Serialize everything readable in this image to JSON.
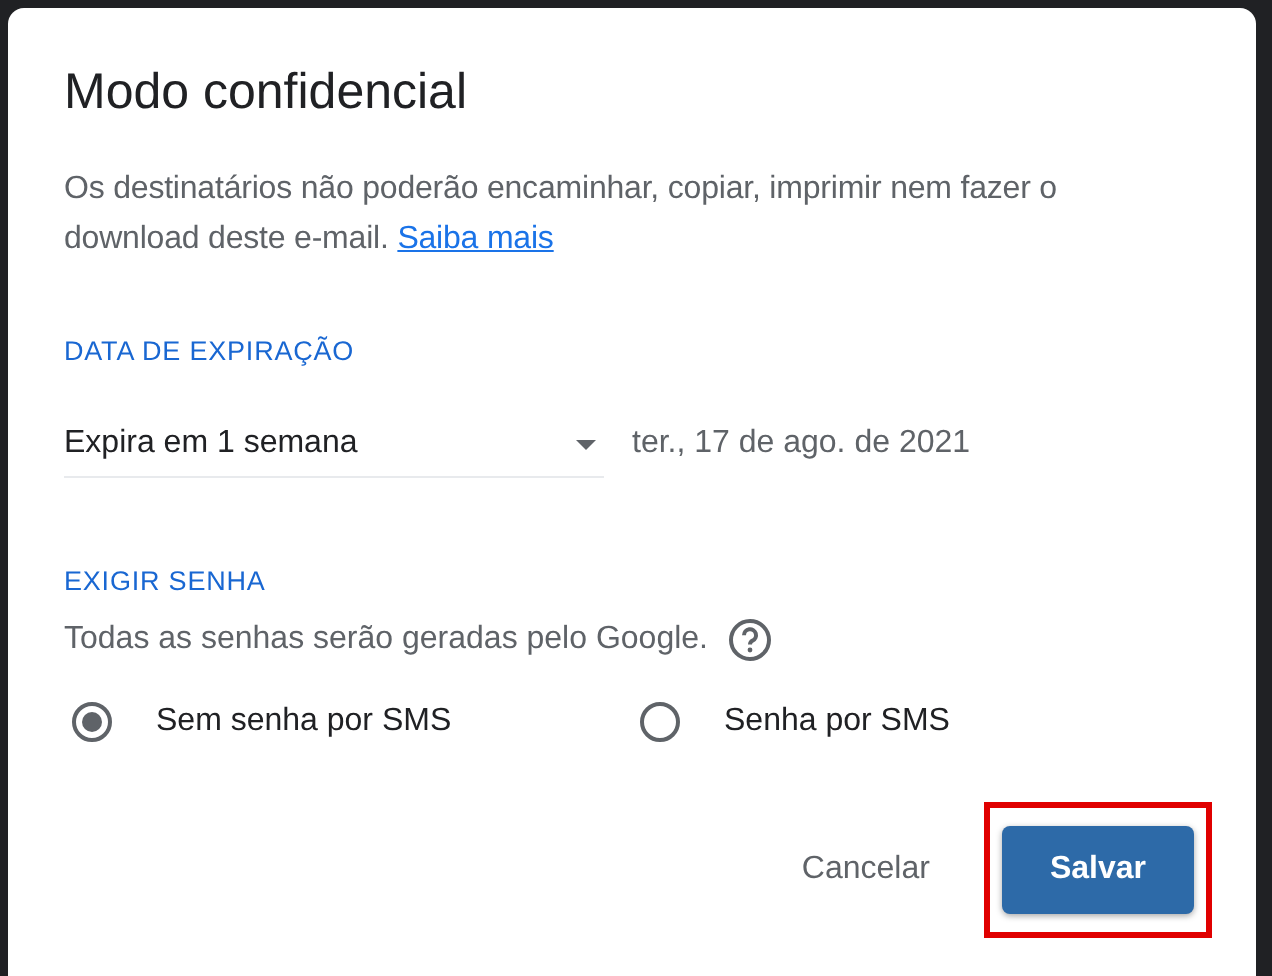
{
  "dialog": {
    "title": "Modo confidencial",
    "description": {
      "text": "Os destinatários não poderão encaminhar, copiar, imprimir nem fazer o download deste e-mail.",
      "link": "Saiba mais"
    },
    "expiration": {
      "heading": "DATA DE EXPIRAÇÃO",
      "select_value": "Expira em 1 semana",
      "date": "ter., 17 de ago. de 2021"
    },
    "password": {
      "heading": "EXIGIR SENHA",
      "hint": "Todas as senhas serão geradas pelo Google.",
      "options": [
        {
          "label": "Sem senha por SMS",
          "selected": true
        },
        {
          "label": "Senha por SMS",
          "selected": false
        }
      ]
    },
    "buttons": [
      {
        "label": "Cancelar",
        "kind": "text",
        "highlighted": false
      },
      {
        "label": "Salvar",
        "kind": "primary",
        "highlighted": true
      }
    ]
  }
}
